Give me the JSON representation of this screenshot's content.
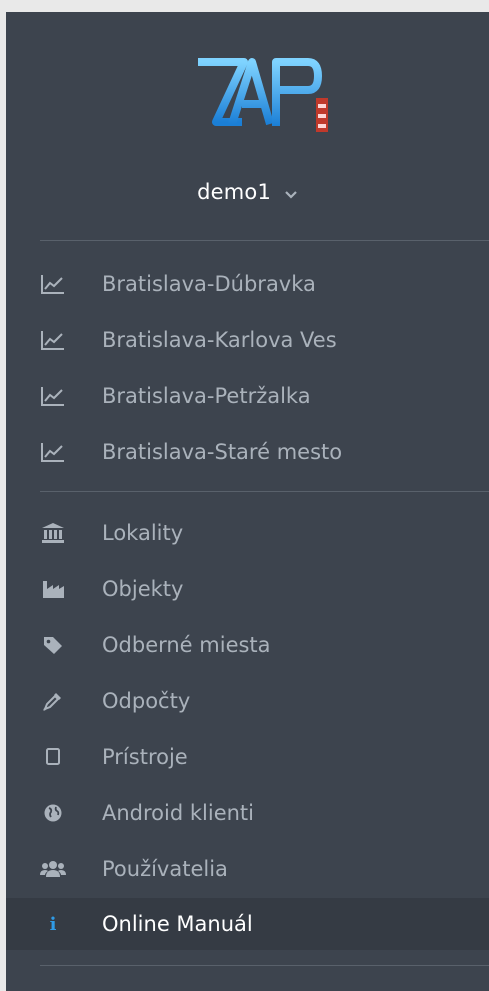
{
  "user": {
    "name": "demo1"
  },
  "icons": {
    "stations": "area-chart-icon",
    "lokality": "bank-icon",
    "objekty": "industry-icon",
    "odberne": "tag-icon",
    "odpocty": "eyedropper-icon",
    "pristroje": "tablet-icon",
    "android": "globe-icon",
    "pouzivatelia": "users-icon",
    "manual": "info-icon"
  },
  "colors": {
    "sidebar_bg": "#3d444e",
    "active_bg": "#353b44",
    "muted_text": "#aab2bb",
    "info_accent": "#2f9be6"
  },
  "stations": [
    {
      "label": "Bratislava-Dúbravka"
    },
    {
      "label": "Bratislava-Karlova Ves"
    },
    {
      "label": "Bratislava-Petržalka"
    },
    {
      "label": "Bratislava-Staré mesto"
    }
  ],
  "menu": {
    "lokality": "Lokality",
    "objekty": "Objekty",
    "odberne": "Odberné miesta",
    "odpocty": "Odpočty",
    "pristroje": "Prístroje",
    "android": "Android klienti",
    "pouzivatelia": "Používatelia",
    "manual": "Online Manuál"
  }
}
